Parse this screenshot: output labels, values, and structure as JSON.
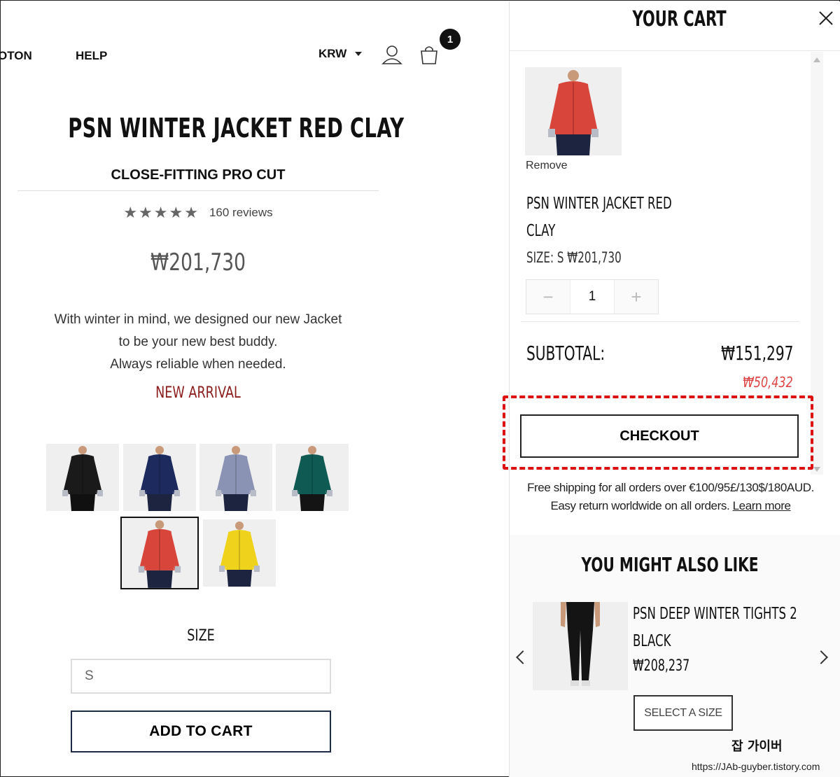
{
  "nav": {
    "items": [
      "OTON",
      "HELP"
    ],
    "currency": "KRW",
    "cart_count": "1"
  },
  "product": {
    "title": "PSN WINTER JACKET RED CLAY",
    "cut": "CLOSE-FITTING PRO CUT",
    "stars": "★★★★★",
    "rating": 5,
    "reviews": "160 reviews",
    "price": "₩201,730",
    "description": [
      "With winter in mind, we designed our new Jacket",
      "to be your new best buddy.",
      "Always reliable when needed."
    ],
    "badge": "NEW ARRIVAL",
    "colors": [
      {
        "name": "black",
        "hex": "#1a1a1a"
      },
      {
        "name": "navy",
        "hex": "#1c2a5e"
      },
      {
        "name": "grey-blue",
        "hex": "#8a93b3"
      },
      {
        "name": "teal",
        "hex": "#0f5a52"
      },
      {
        "name": "red-clay",
        "hex": "#d8453a",
        "selected": true
      },
      {
        "name": "yellow",
        "hex": "#efd21c"
      }
    ],
    "size_label": "SIZE",
    "size_value": "S",
    "add_to_cart": "ADD TO CART"
  },
  "cart": {
    "title": "YOUR CART",
    "remove": "Remove",
    "item_name_line1": "PSN WINTER JACKET RED",
    "item_name_line2": "CLAY",
    "item_size_price": "SIZE: S  ₩201,730",
    "qty_minus": "−",
    "qty_value": "1",
    "qty_plus": "+",
    "subtotal_label": "SUBTOTAL:",
    "subtotal_value": "₩151,297",
    "subtotal_old": "₩50,432",
    "checkout": "CHECKOUT",
    "ship_line1": "Free shipping for all orders over €100/95£/130$/180AUD.",
    "ship_line2": "Easy return worldwide on all orders.",
    "learn_more": "Learn more",
    "accent_color": "#d11111"
  },
  "also_like": {
    "title": "YOU MIGHT ALSO LIKE",
    "name_line1": "PSN DEEP WINTER TIGHTS 2",
    "name_line2": "BLACK",
    "price": "₩208,237",
    "select_size": "SELECT A SIZE"
  },
  "watermark": {
    "name": "잡 가이버",
    "url": "https://JAb-guyber.tistory.com"
  }
}
